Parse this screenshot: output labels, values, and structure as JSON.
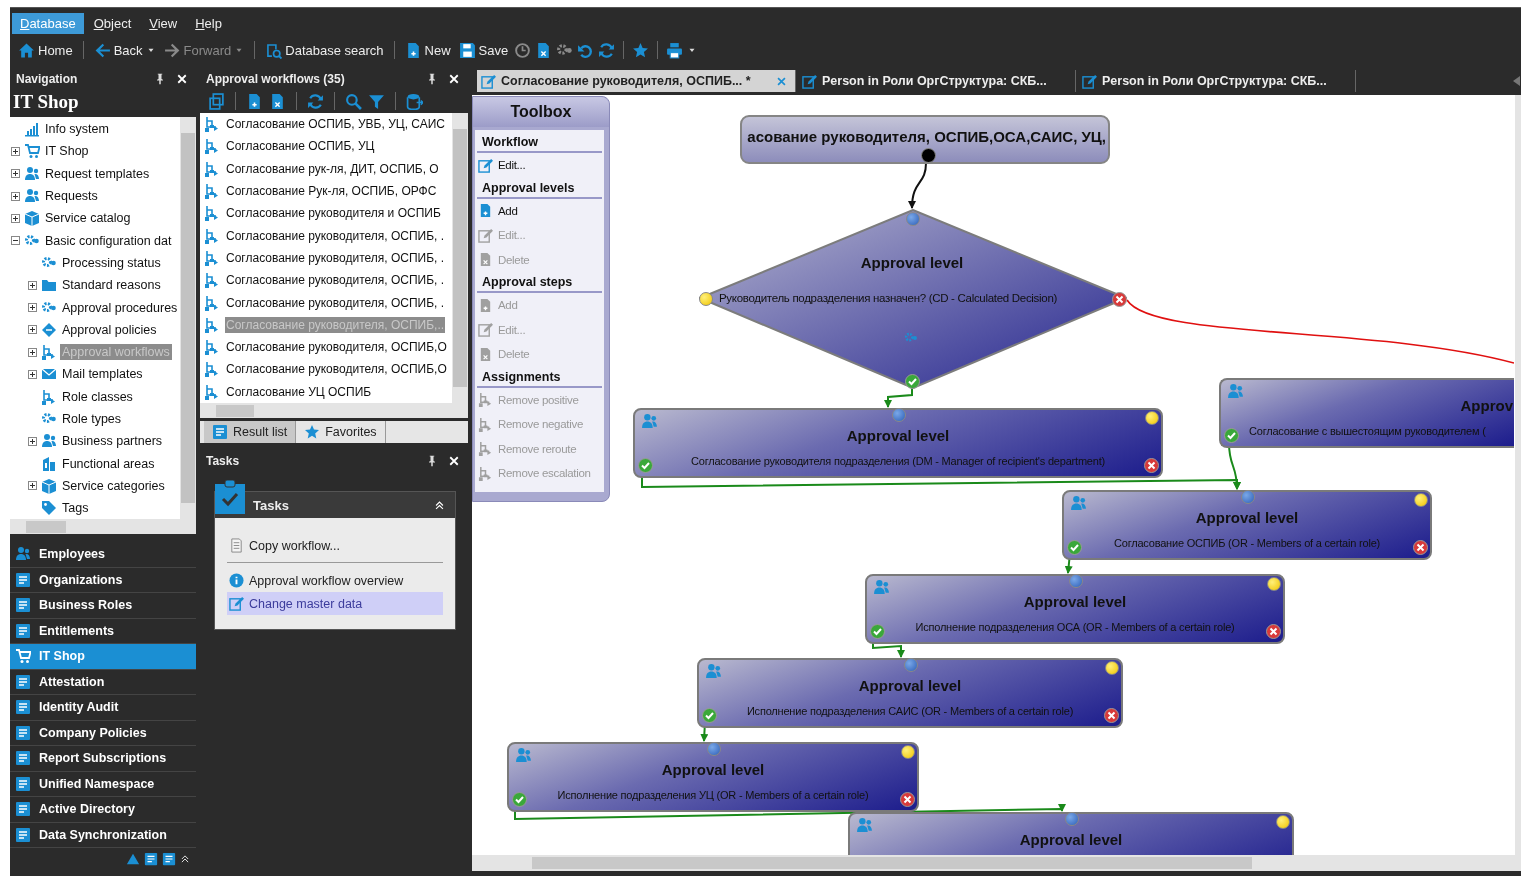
{
  "menu": [
    {
      "label": "Database",
      "selected": true
    },
    {
      "label": "Object",
      "selected": false
    },
    {
      "label": "View",
      "selected": false
    },
    {
      "label": "Help",
      "selected": false
    }
  ],
  "toolbar": [
    {
      "label": "Home",
      "disabled": false,
      "caret": false
    },
    {
      "label": "Back",
      "disabled": false,
      "caret": true
    },
    {
      "label": "Forward",
      "disabled": true,
      "caret": true
    },
    {
      "label": "Database search",
      "disabled": false,
      "caret": false
    },
    {
      "label": "New",
      "disabled": false,
      "caret": false
    },
    {
      "label": "Save",
      "disabled": false,
      "caret": false
    }
  ],
  "navigation": {
    "title": "Navigation",
    "heading": "IT Shop",
    "tree": [
      {
        "label": "Info system",
        "kind": "leaf",
        "selected": false
      },
      {
        "label": "IT Shop",
        "kind": "collapsed",
        "selected": false
      },
      {
        "label": "Request templates",
        "kind": "collapsed",
        "selected": false
      },
      {
        "label": "Requests",
        "kind": "collapsed",
        "selected": false
      },
      {
        "label": "Service catalog",
        "kind": "collapsed",
        "selected": false
      },
      {
        "label": "Basic configuration dat",
        "kind": "expanded",
        "selected": false,
        "children": [
          {
            "label": "Processing status",
            "kind": "leaf",
            "selected": false
          },
          {
            "label": "Standard reasons",
            "kind": "collapsed",
            "selected": false
          },
          {
            "label": "Approval procedures",
            "kind": "collapsed",
            "selected": false
          },
          {
            "label": "Approval policies",
            "kind": "collapsed",
            "selected": false
          },
          {
            "label": "Approval workflows",
            "kind": "collapsed",
            "selected": true
          },
          {
            "label": "Mail templates",
            "kind": "collapsed",
            "selected": false
          },
          {
            "label": "Role classes",
            "kind": "leaf",
            "selected": false
          },
          {
            "label": "Role types",
            "kind": "leaf",
            "selected": false
          },
          {
            "label": "Business partners",
            "kind": "collapsed",
            "selected": false
          },
          {
            "label": "Functional areas",
            "kind": "leaf",
            "selected": false
          },
          {
            "label": "Service categories",
            "kind": "collapsed",
            "selected": false
          },
          {
            "label": "Tags",
            "kind": "leaf",
            "selected": false
          }
        ]
      }
    ],
    "sections": [
      {
        "label": "Employees",
        "selected": false
      },
      {
        "label": "Organizations",
        "selected": false
      },
      {
        "label": "Business Roles",
        "selected": false
      },
      {
        "label": "Entitlements",
        "selected": false
      },
      {
        "label": "IT Shop",
        "selected": true
      },
      {
        "label": "Attestation",
        "selected": false
      },
      {
        "label": "Identity Audit",
        "selected": false
      },
      {
        "label": "Company Policies",
        "selected": false
      },
      {
        "label": "Report Subscriptions",
        "selected": false
      },
      {
        "label": "Unified Namespace",
        "selected": false
      },
      {
        "label": "Active Directory",
        "selected": false
      },
      {
        "label": "Data Synchronization",
        "selected": false
      }
    ]
  },
  "workflows": {
    "title": "Approval workflows (35)",
    "items": [
      {
        "label": "Согласование ОСПИБ, УВБ, УЦ, САИС",
        "selected": false
      },
      {
        "label": "Согласование ОСПИБ, УЦ",
        "selected": false
      },
      {
        "label": "Согласование рук-ля, ДИТ, ОСПИБ, О",
        "selected": false
      },
      {
        "label": "Согласование Рук-ля, ОСПИБ, ОРФС",
        "selected": false
      },
      {
        "label": "Согласование руководителя и ОСПИБ",
        "selected": false
      },
      {
        "label": "Согласование руководителя, ОСПИБ, .",
        "selected": false
      },
      {
        "label": "Согласование руководителя, ОСПИБ, .",
        "selected": false
      },
      {
        "label": "Согласование руководителя, ОСПИБ, .",
        "selected": false
      },
      {
        "label": "Согласование руководителя, ОСПИБ, .",
        "selected": false
      },
      {
        "label": "Согласование руководителя, ОСПИБ,..",
        "selected": true
      },
      {
        "label": "Согласование руководителя, ОСПИБ,О",
        "selected": false
      },
      {
        "label": "Согласование руководителя, ОСПИБ,О",
        "selected": false
      },
      {
        "label": "Согласование УЦ ОСПИБ",
        "selected": false
      }
    ],
    "tabs": [
      {
        "label": "Result list",
        "selected": true
      },
      {
        "label": "Favorites",
        "selected": false
      }
    ]
  },
  "tasks": {
    "title": "Tasks",
    "card_title": "Tasks",
    "items": [
      {
        "label": "Copy workflow...",
        "selected": false
      },
      {
        "label": "Approval workflow overview",
        "selected": false
      },
      {
        "label": "Change master data",
        "selected": true
      }
    ]
  },
  "documents": {
    "tabs": [
      {
        "label": "Согласование руководителя, ОСПИБ... *",
        "selected": true
      },
      {
        "label": "Person in Роли ОргСтруктура: СКБ...",
        "selected": false
      },
      {
        "label": "Person in Роли ОргСтруктура: СКБ...",
        "selected": false
      }
    ]
  },
  "toolbox": {
    "title": "Toolbox",
    "sections": [
      {
        "title": "Workflow",
        "items": [
          {
            "label": "Edit...",
            "disabled": false
          }
        ]
      },
      {
        "title": "Approval levels",
        "items": [
          {
            "label": "Add",
            "disabled": false
          },
          {
            "label": "Edit...",
            "disabled": true
          },
          {
            "label": "Delete",
            "disabled": true
          }
        ]
      },
      {
        "title": "Approval steps",
        "items": [
          {
            "label": "Add",
            "disabled": true
          },
          {
            "label": "Edit...",
            "disabled": true
          },
          {
            "label": "Delete",
            "disabled": true
          }
        ]
      },
      {
        "title": "Assignments",
        "items": [
          {
            "label": "Remove positive",
            "disabled": true
          },
          {
            "label": "Remove negative",
            "disabled": true
          },
          {
            "label": "Remove reroute",
            "disabled": true
          },
          {
            "label": "Remove escalation",
            "disabled": true
          }
        ]
      }
    ]
  },
  "diagram": {
    "start": {
      "title": "асование руководителя, ОСПИБ,ОСА,САИС, УЦ,"
    },
    "decision": {
      "title": "Approval level",
      "condition": "Руководитель подразделения назначен? (CD - Calculated Decision)"
    },
    "levels": [
      {
        "title": "Approval level",
        "description": "Согласование руководителя подразделения (DM - Manager of recipient's department)"
      },
      {
        "title": "Approv",
        "description": "Согласование с вышестоящим руководителем ("
      },
      {
        "title": "Approval level",
        "description": "Согласование ОСПИБ (OR - Members of a certain role)"
      },
      {
        "title": "Approval level",
        "description": "Исполнение подразделения ОСА (OR - Members of a certain role)"
      },
      {
        "title": "Approval level",
        "description": "Исполнение подразделения САИС (OR - Members of a certain role)"
      },
      {
        "title": "Approval level",
        "description": "Исполнение подразделения УЦ (OR - Members of a certain role)"
      },
      {
        "title": "Approval level"
      }
    ]
  }
}
